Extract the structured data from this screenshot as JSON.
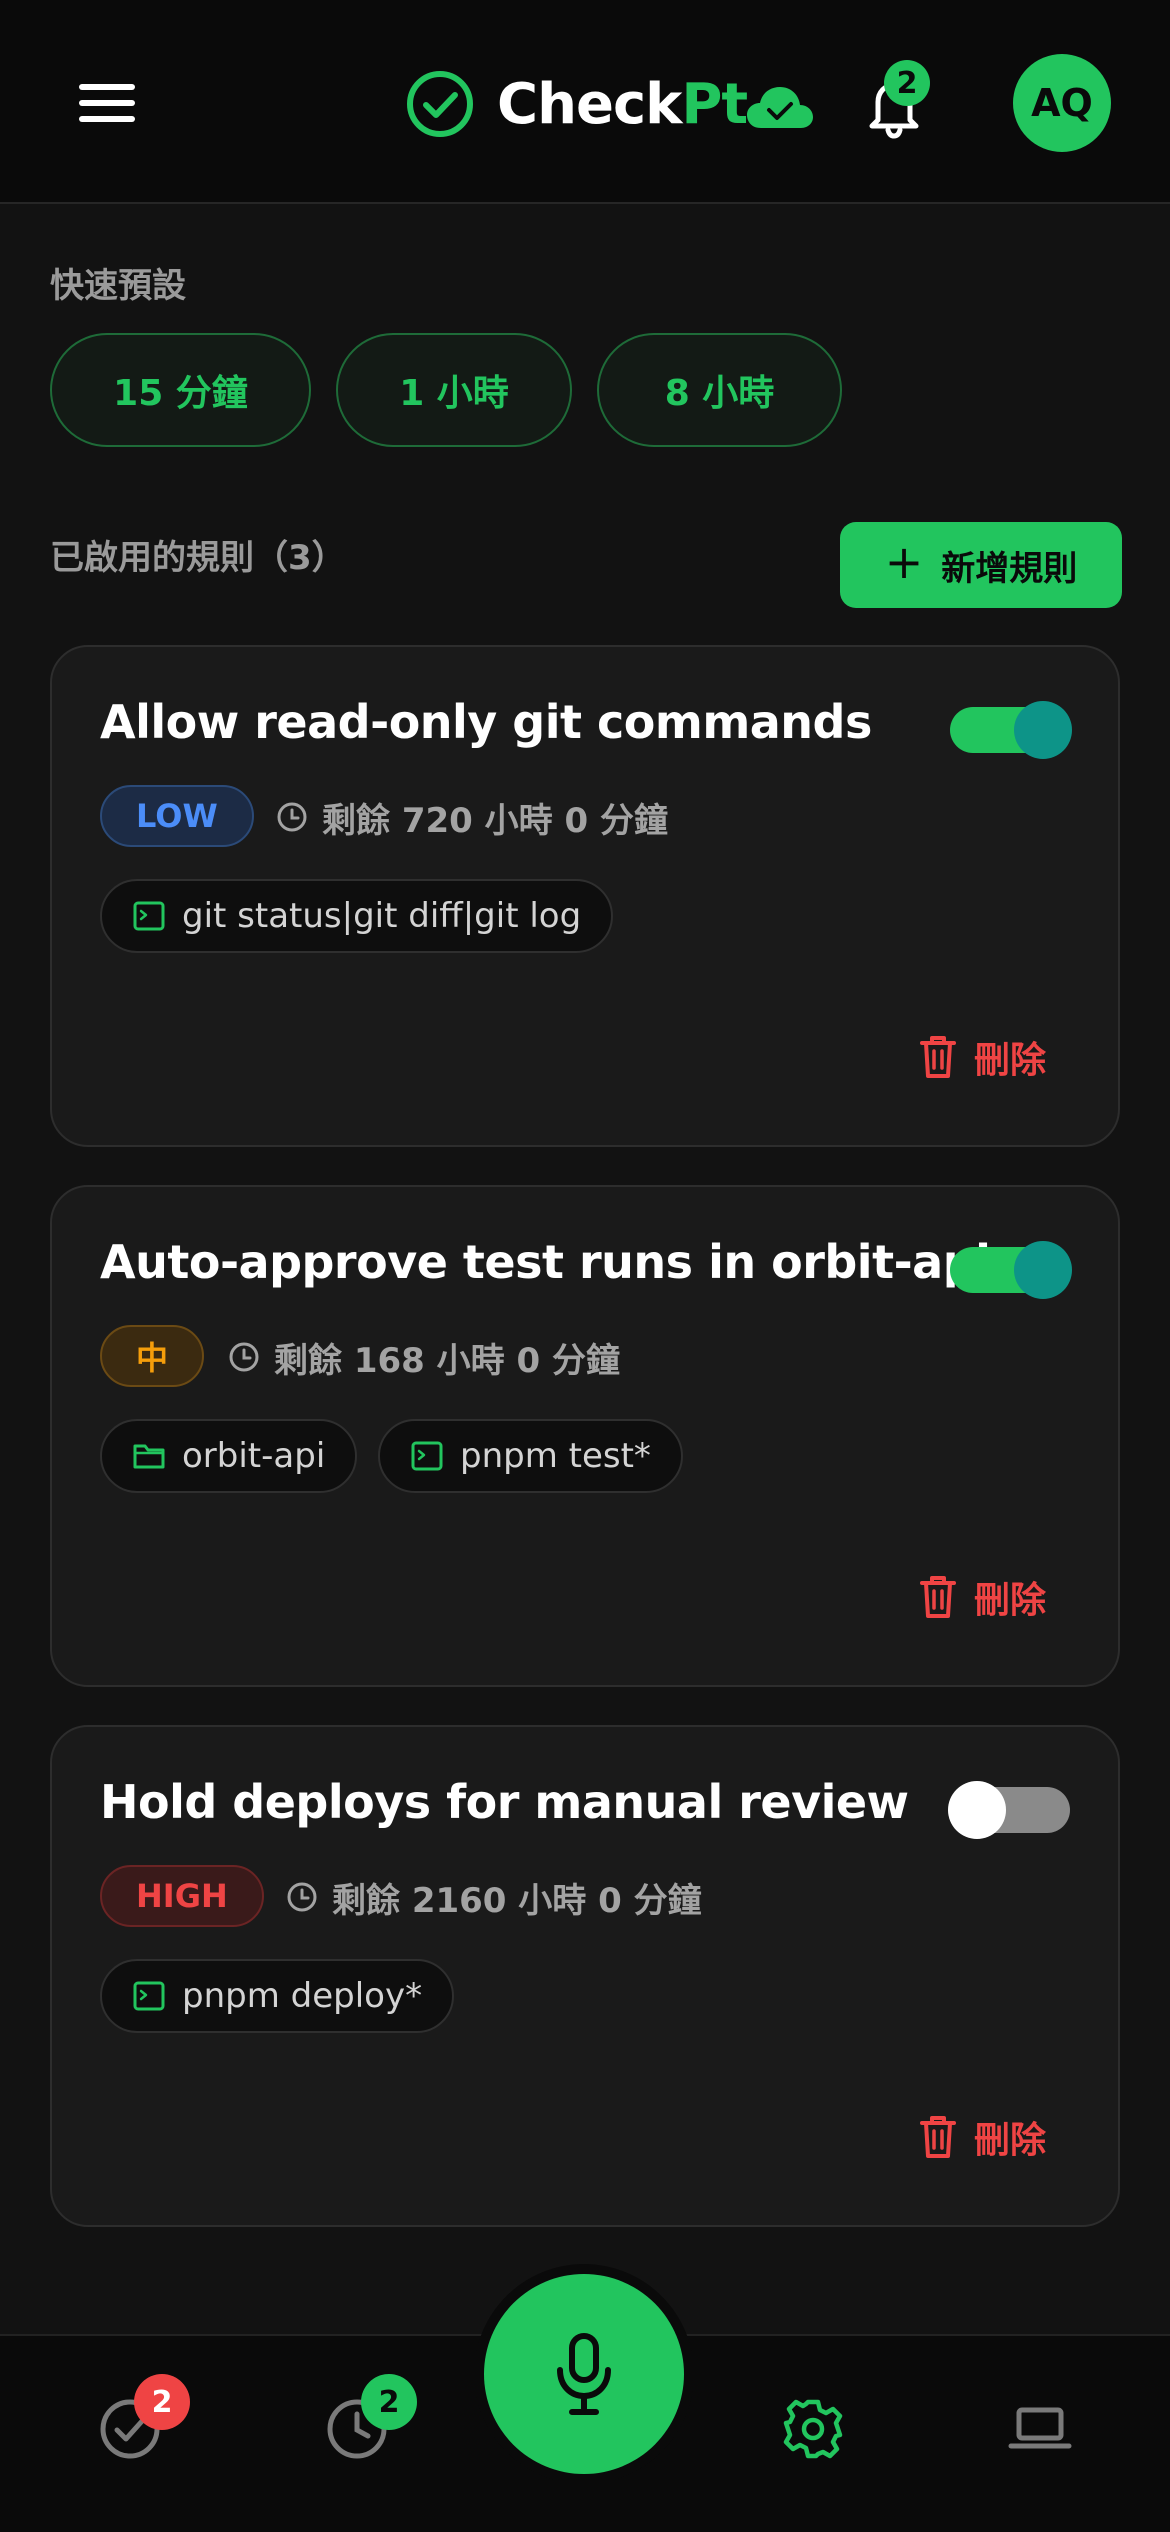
{
  "header": {
    "brand_part1": "Check",
    "brand_part2": "Pt",
    "notification_count": "2",
    "avatar_initials": "AQ"
  },
  "presets": {
    "label": "快速預設",
    "items": [
      "15 分鐘",
      "1 小時",
      "8 小時"
    ]
  },
  "rules": {
    "heading": "已啟用的規則（3）",
    "add_label": "新增規則",
    "delete_label": "刪除",
    "items": [
      {
        "title": "Allow read-only git commands",
        "enabled": true,
        "risk": "LOW",
        "risk_level": "low",
        "remaining": "剩餘 720 小時 0 分鐘",
        "chips": [
          {
            "icon": "terminal-icon",
            "text": "git status|git diff|git log"
          }
        ]
      },
      {
        "title": "Auto-approve test runs in orbit-api",
        "enabled": true,
        "risk": "中",
        "risk_level": "mid",
        "remaining": "剩餘 168 小時 0 分鐘",
        "chips": [
          {
            "icon": "folder-icon",
            "text": "orbit-api"
          },
          {
            "icon": "terminal-icon",
            "text": "pnpm test*"
          }
        ]
      },
      {
        "title": "Hold deploys for manual review",
        "enabled": false,
        "risk": "HIGH",
        "risk_level": "high",
        "remaining": "剩餘 2160 小時 0 分鐘",
        "chips": [
          {
            "icon": "terminal-icon",
            "text": "pnpm deploy*"
          }
        ]
      }
    ]
  },
  "bottom_nav": {
    "approvals_badge": "2",
    "history_badge": "2",
    "items": [
      "approvals",
      "history",
      "voice",
      "settings",
      "devices"
    ]
  },
  "colors": {
    "accent": "#22c55e",
    "danger": "#ef4444",
    "warning": "#f59e0b",
    "info": "#4b8df8",
    "background": "#121212",
    "card": "#1a1a1a"
  }
}
